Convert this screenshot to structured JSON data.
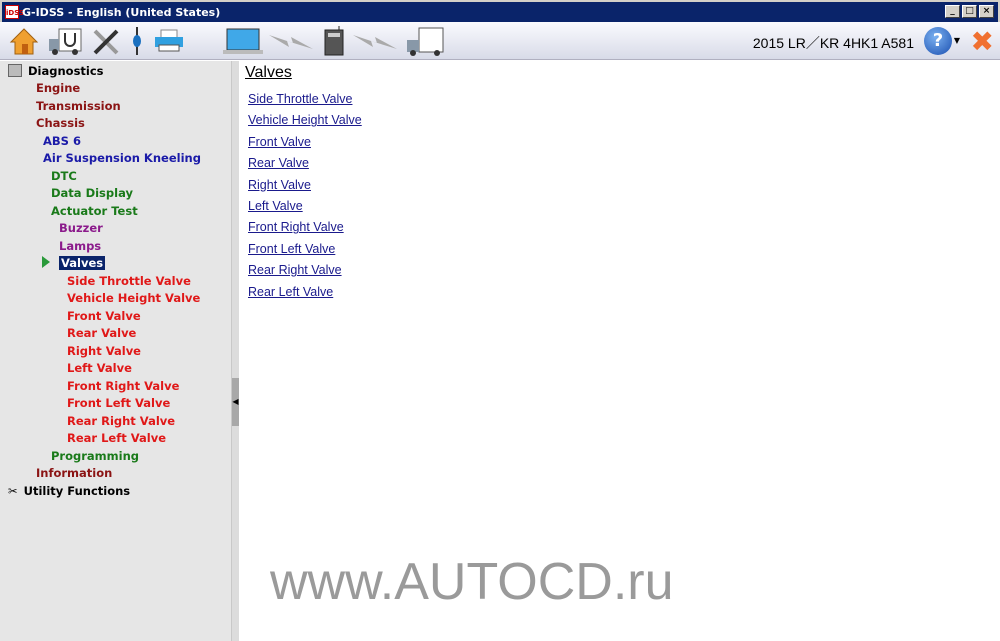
{
  "window": {
    "title": "G-IDSS - English (United States)",
    "app_icon": "iDSS",
    "controls": [
      "_",
      "□",
      "×"
    ]
  },
  "toolbar": {
    "vehicle": "2015 LR／KR 4HK1 A581",
    "help": "?",
    "icons": [
      "home-icon",
      "truck-diagnosis-icon",
      "tools-icon",
      "divider-icon",
      "printer-icon",
      "laptop-icon",
      "lightning-icon",
      "vci-device-icon",
      "lightning-icon",
      "truck-icon"
    ]
  },
  "tree": {
    "root": "Diagnostics",
    "items": [
      {
        "label": "Engine",
        "level": 1
      },
      {
        "label": "Transmission",
        "level": 1
      },
      {
        "label": "Chassis",
        "level": 1
      },
      {
        "label": "ABS 6",
        "level": 2
      },
      {
        "label": "Air Suspension Kneeling",
        "level": 2
      },
      {
        "label": "DTC",
        "level": 3
      },
      {
        "label": "Data Display",
        "level": 3
      },
      {
        "label": "Actuator Test",
        "level": 3
      },
      {
        "label": "Buzzer",
        "level": 4
      },
      {
        "label": "Lamps",
        "level": 4
      },
      {
        "label": "Valves",
        "level": 4,
        "selected": true
      },
      {
        "label": "Side Throttle Valve",
        "level": 5
      },
      {
        "label": "Vehicle Height Valve",
        "level": 5
      },
      {
        "label": "Front Valve",
        "level": 5
      },
      {
        "label": "Rear Valve",
        "level": 5
      },
      {
        "label": "Right Valve",
        "level": 5
      },
      {
        "label": "Left Valve",
        "level": 5
      },
      {
        "label": "Front Right Valve",
        "level": 5
      },
      {
        "label": "Front Left Valve",
        "level": 5
      },
      {
        "label": "Rear Right Valve",
        "level": 5
      },
      {
        "label": "Rear Left Valve",
        "level": 5
      },
      {
        "label": "Programming",
        "level": 3
      },
      {
        "label": "Information",
        "level": 1
      }
    ],
    "utility": "Utility Functions"
  },
  "content": {
    "heading": "Valves",
    "links": [
      "Side Throttle Valve",
      "Vehicle Height Valve",
      "Front Valve",
      "Rear Valve",
      "Right Valve",
      "Left Valve",
      "Front Right Valve",
      "Front Left Valve",
      "Rear Right Valve",
      "Rear Left Valve"
    ]
  },
  "watermark": "www.AUTOCD.ru"
}
